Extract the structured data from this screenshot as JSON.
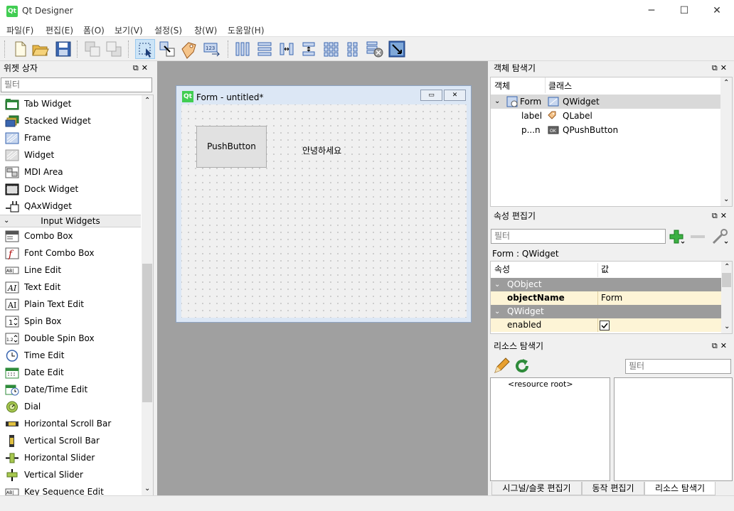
{
  "app": {
    "title": "Qt Designer",
    "icon_label": "Qt"
  },
  "window_controls": {
    "minimize": "─",
    "maximize": "☐",
    "close": "✕"
  },
  "menu": [
    "파일(F)",
    "편집(E)",
    "폼(O)",
    "보기(V)",
    "설정(S)",
    "창(W)",
    "도움말(H)"
  ],
  "widget_box": {
    "title": "위젯 상자",
    "filter_placeholder": "필터",
    "items_top": [
      "Tab Widget",
      "Stacked Widget",
      "Frame",
      "Widget",
      "MDI Area",
      "Dock Widget",
      "QAxWidget"
    ],
    "category": "Input Widgets",
    "items_input": [
      "Combo Box",
      "Font Combo Box",
      "Line Edit",
      "Text Edit",
      "Plain Text Edit",
      "Spin Box",
      "Double Spin Box",
      "Time Edit",
      "Date Edit",
      "Date/Time Edit",
      "Dial",
      "Horizontal Scroll Bar",
      "Vertical Scroll Bar",
      "Horizontal Slider",
      "Vertical Slider",
      "Key Sequence Edit"
    ]
  },
  "form": {
    "title": "Form - untitled*",
    "push_button_text": "PushButton",
    "label_text": "안녕하세요"
  },
  "object_inspector": {
    "title": "객체 탐색기",
    "col_object": "객체",
    "col_class": "클래스",
    "rows": [
      {
        "object": "Form",
        "class": "QWidget"
      },
      {
        "object": "label",
        "class": "QLabel"
      },
      {
        "object": "p...n",
        "class": "QPushButton"
      }
    ]
  },
  "property_editor": {
    "title": "속성 편집기",
    "filter_placeholder": "필터",
    "context": "Form : QWidget",
    "col_property": "속성",
    "col_value": "값",
    "group_qobject": "QObject",
    "prop_objectname": "objectName",
    "val_objectname": "Form",
    "group_qwidget": "QWidget",
    "prop_enabled": "enabled",
    "enabled_checked": true
  },
  "resource_browser": {
    "title": "리소스 탐색기",
    "filter_placeholder": "필터",
    "root": "<resource root>"
  },
  "bottom_tabs": [
    "시그널/슬롯 편집기",
    "동작 편집기",
    "리소스 탐색기"
  ],
  "colors": {
    "accent": "#41cd52",
    "selection": "#cce4f7",
    "group_header": "#9c9c9c",
    "highlight_row": "#fdf4d6"
  }
}
